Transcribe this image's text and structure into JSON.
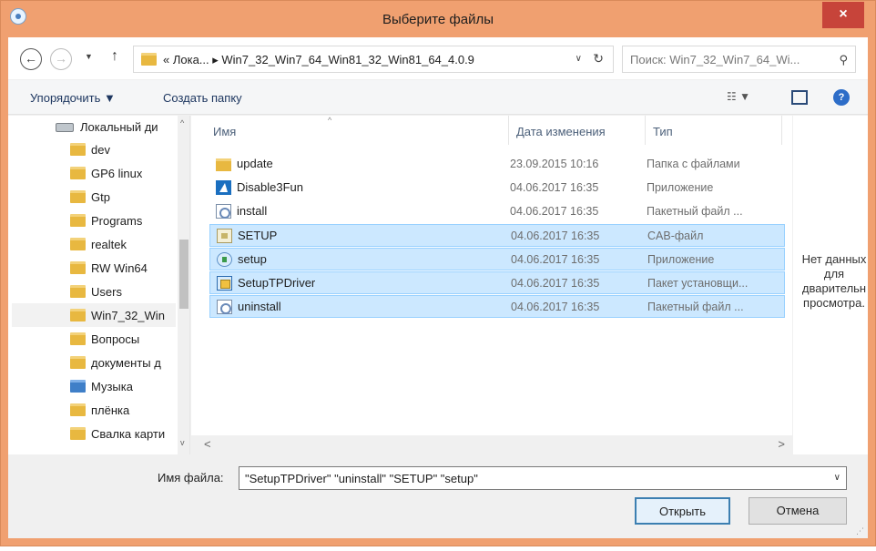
{
  "window": {
    "title": "Выберите файлы",
    "close_label": "×"
  },
  "nav": {
    "back_label": "←",
    "forward_label": "→",
    "recent_label": "▼",
    "up_label": "↑",
    "address": "«  Лока...  ▸  Win7_32_Win7_64_Win81_32_Win81_64_4.0.9",
    "address_dropdown": "∨",
    "refresh_label": "↻",
    "search_placeholder": "Поиск: Win7_32_Win7_64_Wi...",
    "search_icon": "⚲"
  },
  "toolbar": {
    "organize_label": "Упорядочить ▼",
    "new_folder_label": "Создать папку",
    "view_label": "☷ ▼",
    "help_label": "?"
  },
  "navpane": {
    "drive": "Локальный ди",
    "items": [
      "dev",
      "GP6 linux",
      "Gtp",
      "Programs",
      "realtek",
      "RW Win64",
      "Users",
      "Win7_32_Win",
      "Вопросы",
      "документы д",
      "Музыка",
      "плёнка",
      "Свалка карти"
    ],
    "selected_index": 7,
    "scroll_up": "^",
    "scroll_down": "v"
  },
  "filelist": {
    "columns": {
      "name": "Имя",
      "date": "Дата изменения",
      "type": "Тип"
    },
    "rows": [
      {
        "name": "update",
        "date": "23.09.2015 10:16",
        "type": "Папка с файлами",
        "icon": "folder-icon",
        "selected": false
      },
      {
        "name": "Disable3Fun",
        "date": "04.06.2017 16:35",
        "type": "Приложение",
        "icon": "app-icon",
        "selected": false
      },
      {
        "name": "install",
        "date": "04.06.2017 16:35",
        "type": "Пакетный файл ...",
        "icon": "batch-file-icon",
        "selected": false
      },
      {
        "name": "SETUP",
        "date": "04.06.2017 16:35",
        "type": "CAB-файл",
        "icon": "cab-file-icon",
        "selected": true
      },
      {
        "name": "setup",
        "date": "04.06.2017 16:35",
        "type": "Приложение",
        "icon": "setup-app-icon",
        "selected": true
      },
      {
        "name": "SetupTPDriver",
        "date": "04.06.2017 16:35",
        "type": "Пакет установщи...",
        "icon": "installer-package-icon",
        "selected": true
      },
      {
        "name": "uninstall",
        "date": "04.06.2017 16:35",
        "type": "Пакетный файл ...",
        "icon": "batch-file-icon",
        "selected": true
      }
    ],
    "hscroll_left": "<",
    "hscroll_right": ">"
  },
  "preview": {
    "line1": "Нет данных",
    "line2": "для",
    "line3": "дварительн",
    "line4": "просмотра."
  },
  "bottom": {
    "filename_label": "Имя файла:",
    "filename_value": "\"SetupTPDriver\" \"uninstall\" \"SETUP\" \"setup\"",
    "filename_drop": "∨",
    "open_label": "Открыть",
    "cancel_label": "Отмена"
  }
}
